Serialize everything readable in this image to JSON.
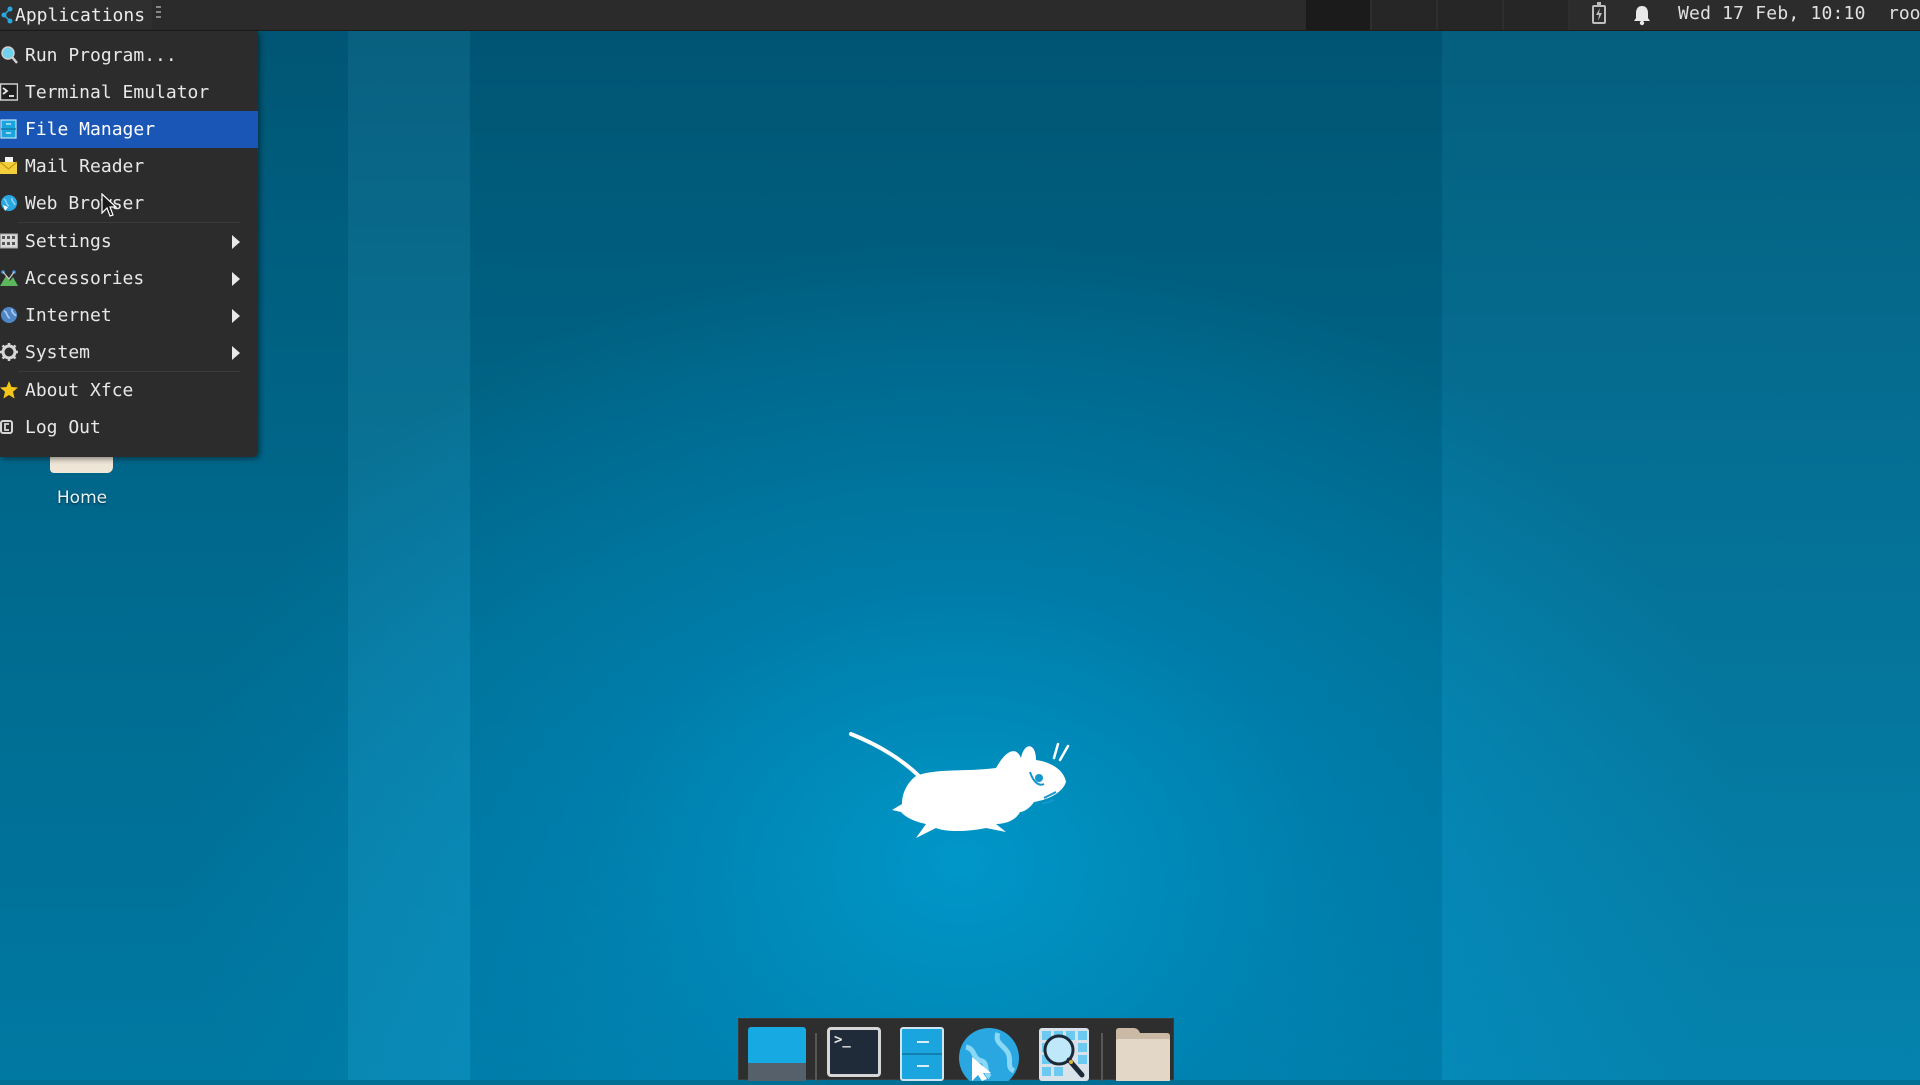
{
  "top_panel": {
    "applications_label": "Applications",
    "applications_icon": "xfce-menu-icon",
    "workspaces": [
      {
        "name": "Workspace 1",
        "active": true
      },
      {
        "name": "Workspace 2",
        "active": false
      },
      {
        "name": "Workspace 3",
        "active": false
      },
      {
        "name": "Workspace 4",
        "active": false
      }
    ],
    "tray": {
      "battery_icon": "battery-charging-icon",
      "notification_icon": "bell-icon",
      "clock": "Wed 17 Feb, 10:10",
      "user": "root"
    }
  },
  "app_menu": {
    "items": [
      {
        "label": "Run Program...",
        "icon": "run-program-icon",
        "submenu": false
      },
      {
        "label": "Terminal Emulator",
        "icon": "terminal-icon",
        "submenu": false
      },
      {
        "label": "File Manager",
        "icon": "file-manager-icon",
        "submenu": false,
        "selected": true
      },
      {
        "label": "Mail Reader",
        "icon": "mail-icon",
        "submenu": false
      },
      {
        "label": "Web Browser",
        "icon": "web-browser-icon",
        "submenu": false
      },
      {
        "label": "Settings",
        "icon": "settings-icon",
        "submenu": true
      },
      {
        "label": "Accessories",
        "icon": "accessories-icon",
        "submenu": true
      },
      {
        "label": "Internet",
        "icon": "internet-icon",
        "submenu": true
      },
      {
        "label": "System",
        "icon": "system-gear-icon",
        "submenu": true
      },
      {
        "label": "About Xfce",
        "icon": "star-icon",
        "submenu": false
      },
      {
        "label": "Log Out",
        "icon": "log-out-icon",
        "submenu": false
      }
    ]
  },
  "desktop": {
    "icons": [
      {
        "label": "Home",
        "icon": "home-folder-icon"
      }
    ],
    "colors": {
      "accent": "#1a56b5",
      "background": "#006f93",
      "panel": "#2b2b2b"
    }
  },
  "dock": {
    "items": [
      {
        "name": "Show Desktop",
        "icon": "show-desktop-icon"
      },
      {
        "name": "Terminal",
        "icon": "terminal-icon"
      },
      {
        "name": "File Manager",
        "icon": "file-cabinet-icon"
      },
      {
        "name": "Web Browser",
        "icon": "globe-icon"
      },
      {
        "name": "Application Finder",
        "icon": "magnifier-icon"
      },
      {
        "name": "Home Folder",
        "icon": "folder-icon"
      }
    ]
  }
}
